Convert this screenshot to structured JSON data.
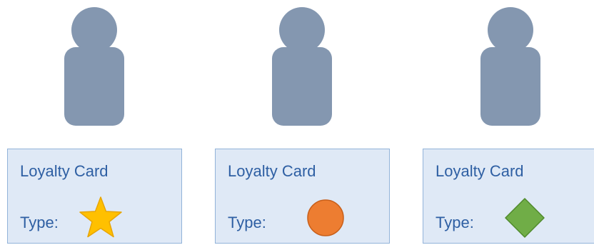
{
  "cards": [
    {
      "title": "Loyalty Card",
      "type_label": "Type:",
      "type_icon": "star-icon",
      "icon_color": "#ffc000"
    },
    {
      "title": "Loyalty Card",
      "type_label": "Type:",
      "type_icon": "circle-icon",
      "icon_color": "#ed7d31"
    },
    {
      "title": "Loyalty Card",
      "type_label": "Type:",
      "type_icon": "diamond-icon",
      "icon_color": "#70ad47"
    }
  ],
  "colors": {
    "person": "#8497b0",
    "card_fill": "#dfe9f6",
    "card_border": "#92b3d9",
    "text": "#2e5fa3"
  }
}
